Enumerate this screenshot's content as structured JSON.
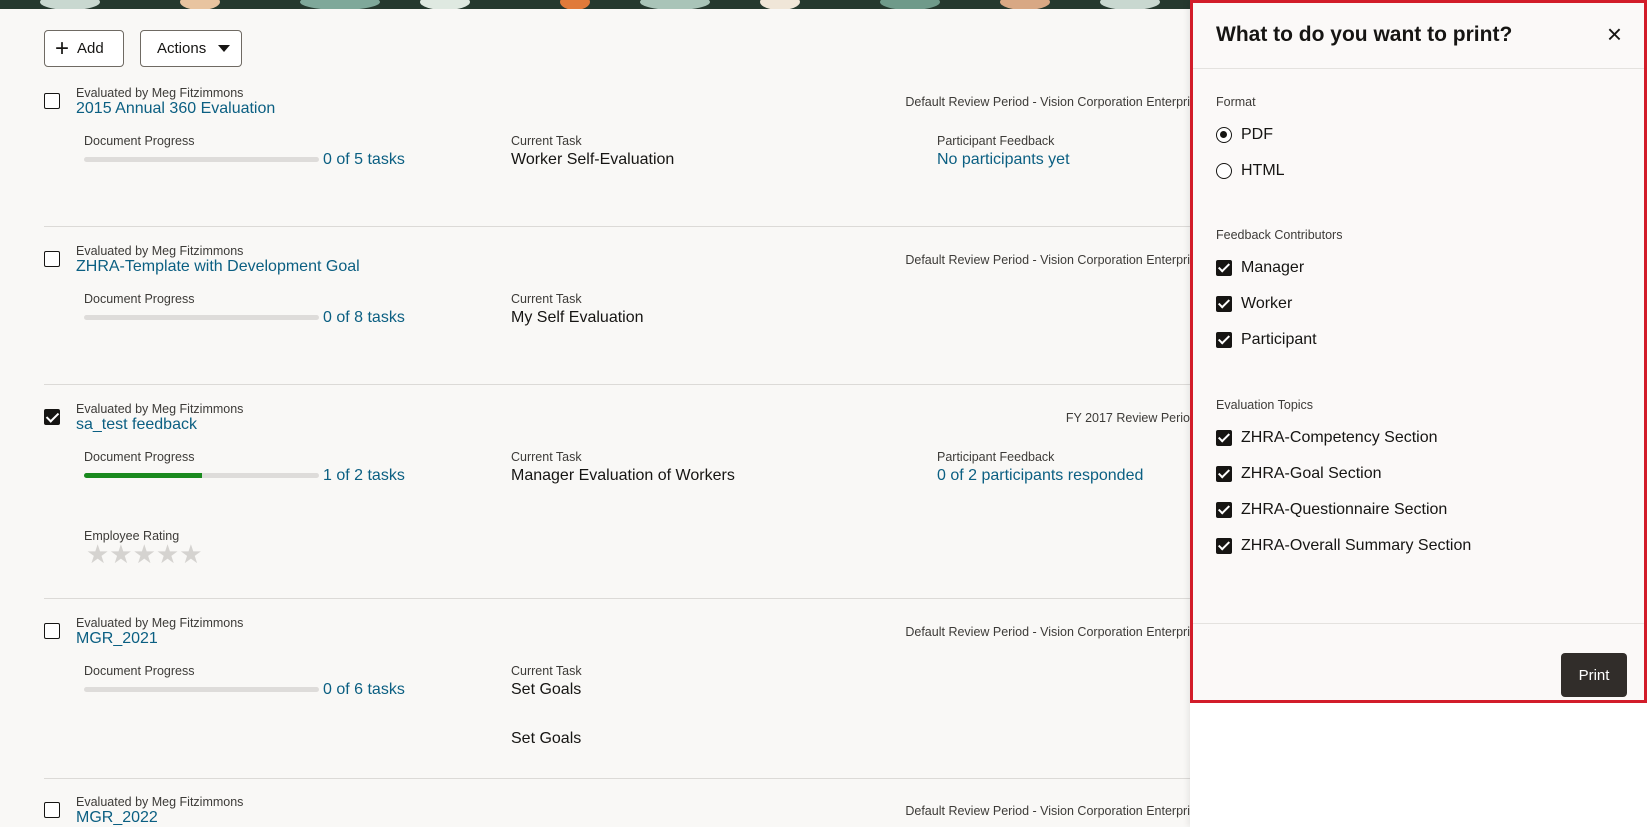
{
  "toolbar": {
    "add_label": "Add",
    "actions_label": "Actions"
  },
  "documents": [
    {
      "evaluated_by": "Evaluated by Meg Fitzimmons",
      "title": "2015 Annual 360 Evaluation",
      "period": "Default Review Period - Vision Corporation Enterpri",
      "checked": false,
      "progress_label": "Document Progress",
      "progress_text": "0 of 5 tasks",
      "progress_fraction": 0,
      "task_label": "Current Task",
      "task": "Worker Self-Evaluation",
      "feedback_label": "Participant Feedback",
      "feedback": "No participants yet"
    },
    {
      "evaluated_by": "Evaluated by Meg Fitzimmons",
      "title": "ZHRA-Template with Development Goal",
      "period": "Default Review Period - Vision Corporation Enterpri",
      "checked": false,
      "progress_label": "Document Progress",
      "progress_text": "0 of 8 tasks",
      "progress_fraction": 0,
      "task_label": "Current Task",
      "task": "My Self Evaluation"
    },
    {
      "evaluated_by": "Evaluated by Meg Fitzimmons",
      "title": "sa_test feedback",
      "period": "FY 2017 Review Perio",
      "checked": true,
      "progress_label": "Document Progress",
      "progress_text": "1 of 2 tasks",
      "progress_fraction": 0.5,
      "task_label": "Current Task",
      "task": "Manager Evaluation of Workers",
      "feedback_label": "Participant Feedback",
      "feedback": "0 of 2 participants responded",
      "rating_label": "Employee Rating",
      "rating_stars": "★★★★★",
      "rating_value": 0,
      "rating_max": 5
    },
    {
      "evaluated_by": "Evaluated by Meg Fitzimmons",
      "title": "MGR_2021",
      "period": "Default Review Period - Vision Corporation Enterpri",
      "checked": false,
      "progress_label": "Document Progress",
      "progress_text": "0 of 6 tasks",
      "progress_fraction": 0,
      "task_label": "Current Task",
      "task": "Set Goals",
      "task_extra": "Set Goals"
    },
    {
      "evaluated_by": "Evaluated by Meg Fitzimmons",
      "title": "MGR_2022",
      "period": "Default Review Period - Vision Corporation Enterpri",
      "checked": false
    }
  ],
  "print_dialog": {
    "title": "What to do you want to print?",
    "close_icon": "×",
    "format_label": "Format",
    "formats": [
      {
        "label": "PDF",
        "selected": true
      },
      {
        "label": "HTML",
        "selected": false
      }
    ],
    "contributors_label": "Feedback Contributors",
    "contributors": [
      {
        "label": "Manager",
        "checked": true
      },
      {
        "label": "Worker",
        "checked": true
      },
      {
        "label": "Participant",
        "checked": true
      }
    ],
    "topics_label": "Evaluation Topics",
    "topics": [
      {
        "label": "ZHRA-Competency Section",
        "checked": true
      },
      {
        "label": "ZHRA-Goal Section",
        "checked": true
      },
      {
        "label": "ZHRA-Questionnaire Section",
        "checked": true
      },
      {
        "label": "ZHRA-Overall Summary Section",
        "checked": true
      }
    ],
    "print_label": "Print"
  },
  "colors": {
    "link": "#0b5f82",
    "progress_fill": "#1a8a1e",
    "highlight_border": "#d21c2a",
    "print_button": "#312d2a"
  }
}
